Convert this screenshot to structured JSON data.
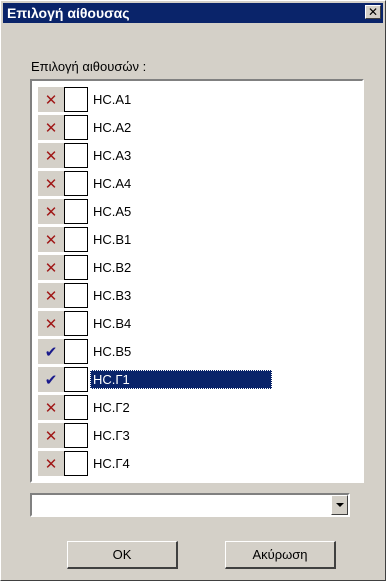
{
  "window": {
    "title": "Επιλογή αίθουσας",
    "close_glyph": "✕"
  },
  "list": {
    "label": "Επιλογή αιθουσών :",
    "items": [
      {
        "status": "x",
        "status_glyph": "✕",
        "label": "HC.A1"
      },
      {
        "status": "x",
        "status_glyph": "✕",
        "label": "HC.A2"
      },
      {
        "status": "x",
        "status_glyph": "✕",
        "label": "HC.A3"
      },
      {
        "status": "x",
        "status_glyph": "✕",
        "label": "HC.A4"
      },
      {
        "status": "x",
        "status_glyph": "✕",
        "label": "HC.A5"
      },
      {
        "status": "x",
        "status_glyph": "✕",
        "label": "HC.B1"
      },
      {
        "status": "x",
        "status_glyph": "✕",
        "label": "HC.B2"
      },
      {
        "status": "x",
        "status_glyph": "✕",
        "label": "HC.B3"
      },
      {
        "status": "x",
        "status_glyph": "✕",
        "label": "HC.B4"
      },
      {
        "status": "check",
        "status_glyph": "✔",
        "label": "HC.B5"
      },
      {
        "status": "check",
        "status_glyph": "✔",
        "label": "HC.Γ1",
        "selected": true
      },
      {
        "status": "x",
        "status_glyph": "✕",
        "label": "HC.Γ2"
      },
      {
        "status": "x",
        "status_glyph": "✕",
        "label": "HC.Γ3"
      },
      {
        "status": "x",
        "status_glyph": "✕",
        "label": "HC.Γ4"
      }
    ]
  },
  "combo": {
    "value": ""
  },
  "buttons": {
    "ok": "OK",
    "cancel": "Ακύρωση"
  },
  "colors": {
    "titlebar": "#0a246a",
    "selection": "#0a246a",
    "x_mark": "#a01818",
    "check_mark": "#1a1a8c",
    "face": "#d4d0c8"
  }
}
